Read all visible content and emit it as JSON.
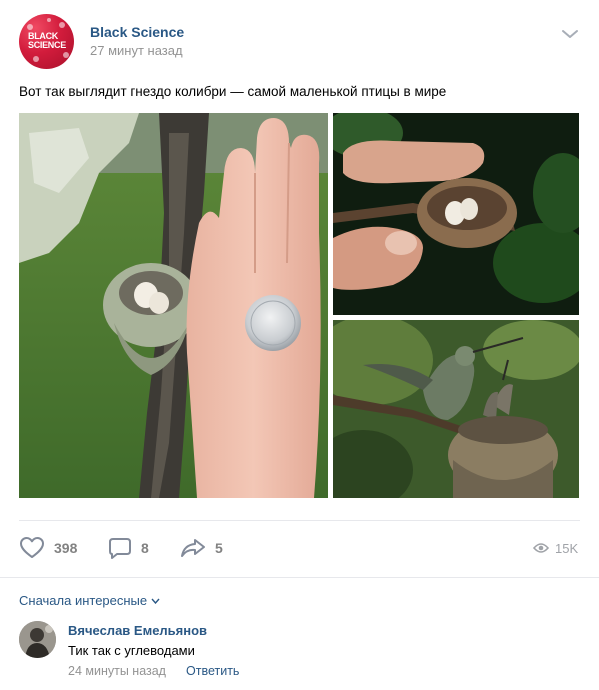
{
  "post": {
    "author": "Black Science",
    "time": "27 минут назад",
    "avatar_logo_line1": "BLACK",
    "avatar_logo_line2": "SCIENCE",
    "text": "Вот так выглядит гнездо колибри — самой маленькой птицы в мире"
  },
  "actions": {
    "likes": "398",
    "comments": "8",
    "shares": "5",
    "views": "15K"
  },
  "comments": {
    "sort_label": "Сначала интересные",
    "items": [
      {
        "author": "Вячеслав Емельянов",
        "text": "Тик так с углеводами",
        "time": "24 минуты назад",
        "reply_label": "Ответить"
      }
    ]
  },
  "icons": {
    "menu": "chevron-down-icon",
    "like": "heart-icon",
    "comment": "speech-bubble-icon",
    "share": "share-arrow-icon",
    "views": "eye-icon"
  },
  "colors": {
    "link": "#2a5885",
    "muted": "#939393",
    "icon": "#828282",
    "brand": "#d21c3c"
  }
}
